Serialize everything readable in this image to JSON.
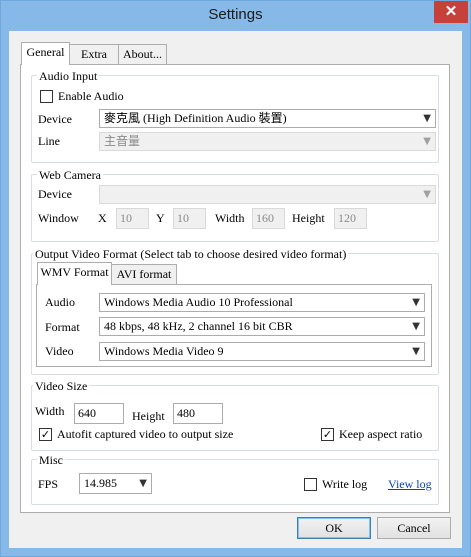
{
  "window": {
    "title": "Settings",
    "close_glyph": "✕"
  },
  "tabs": [
    "General",
    "Extra",
    "About..."
  ],
  "audio_input": {
    "group_label": "Audio Input",
    "enable_label": "Enable Audio",
    "enable_checked": false,
    "device_label": "Device",
    "device_value": "麥克風 (High Definition Audio 裝置)",
    "line_label": "Line",
    "line_value": "主音量"
  },
  "web_camera": {
    "group_label": "Web Camera",
    "device_label": "Device",
    "device_value": "",
    "window_label": "Window",
    "x_label": "X",
    "x_value": "10",
    "y_label": "Y",
    "y_value": "10",
    "width_label": "Width",
    "width_value": "160",
    "height_label": "Height",
    "height_value": "120"
  },
  "output_format": {
    "group_label": "Output Video Format (Select tab to choose desired video format)",
    "tabs": [
      "WMV Format",
      "AVI format"
    ],
    "audio_label": "Audio",
    "audio_value": "Windows Media Audio 10 Professional",
    "format_label": "Format",
    "format_value": "48 kbps, 48 kHz, 2 channel 16 bit CBR",
    "video_label": "Video",
    "video_value": "Windows Media Video 9"
  },
  "video_size": {
    "group_label": "Video Size",
    "width_label": "Width",
    "width_value": "640",
    "height_label": "Height",
    "height_value": "480",
    "autofit_label": "Autofit captured video to output size",
    "autofit_checked": true,
    "keep_aspect_label": "Keep aspect ratio",
    "keep_aspect_checked": true
  },
  "misc": {
    "group_label": "Misc",
    "fps_label": "FPS",
    "fps_value": "14.985",
    "write_log_label": "Write log",
    "write_log_checked": false,
    "view_log_link": "View log"
  },
  "buttons": {
    "ok": "OK",
    "cancel": "Cancel"
  },
  "glyphs": {
    "combo_arrow": "▼",
    "check": "✓"
  }
}
